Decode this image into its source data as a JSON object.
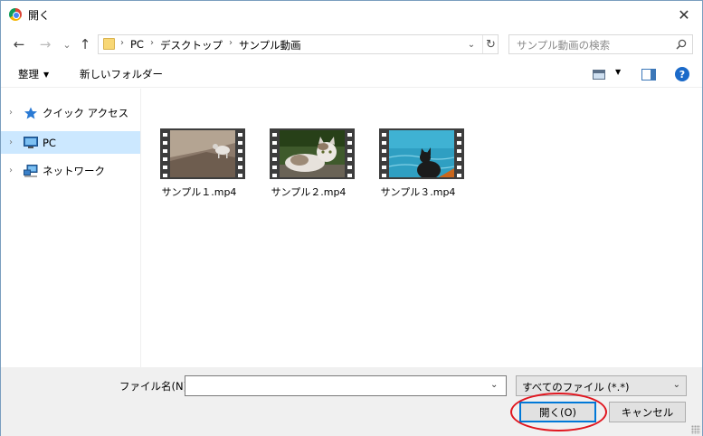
{
  "window": {
    "title": "開く",
    "close_glyph": "✕"
  },
  "nav": {
    "back_glyph": "←",
    "forward_glyph": "→",
    "recent_glyph": "⌄",
    "up_glyph": "↑"
  },
  "address": {
    "crumbs": [
      "PC",
      "デスクトップ",
      "サンプル動画"
    ],
    "separator": "›",
    "dropdown_glyph": "⌄",
    "refresh_glyph": "↻"
  },
  "search": {
    "placeholder": "サンプル動画の検索"
  },
  "toolbar": {
    "organize_label": "整理",
    "new_folder_label": "新しいフォルダー",
    "help_label": "?"
  },
  "sidebar": {
    "items": [
      {
        "label": "クイック アクセス",
        "icon": "star-icon"
      },
      {
        "label": "PC",
        "icon": "computer-icon"
      },
      {
        "label": "ネットワーク",
        "icon": "network-icon"
      }
    ]
  },
  "files": [
    {
      "name": "サンプル１.mp4",
      "thumb": "cat-walking"
    },
    {
      "name": "サンプル２.mp4",
      "thumb": "cat-closeup"
    },
    {
      "name": "サンプル３.mp4",
      "thumb": "cat-by-water"
    }
  ],
  "footer": {
    "filename_label": "ファイル名(N):",
    "filename_value": "",
    "filetype_value": "すべてのファイル (*.*)",
    "open_label": "開く(O)",
    "cancel_label": "キャンセル"
  },
  "colors": {
    "selection": "#cce8ff",
    "accent": "#0078d7",
    "highlight_ring": "#e0161f"
  }
}
